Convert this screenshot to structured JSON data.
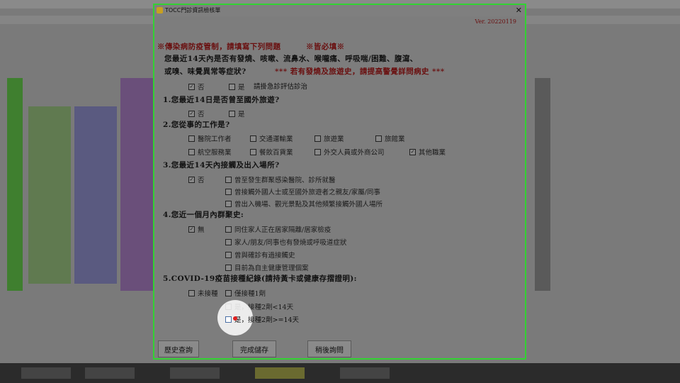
{
  "window": {
    "title": "TOCC門診資訊檢核單",
    "version": "Ver. 20220119"
  },
  "header": {
    "notice": "※傳染病防疫管制，請填寫下列問題",
    "required": "※皆必填※",
    "line1": "您最近14天內是否有發燒、咳嗽、流鼻水、喉嚨痛、呼吸喘/困難、腹瀉、",
    "line2": "或嗅、味覺異常等症狀?",
    "warning": "*** 若有發燒及旅遊史，請提高警覺詳問病史 ***"
  },
  "symptoms": {
    "no": {
      "label": "否",
      "checked": true
    },
    "yes": {
      "label": "是",
      "checked": false
    },
    "yes_note": "請掛急診評估診治"
  },
  "q1": {
    "title": "1.您最近14日是否曾至國外旅遊?",
    "no": {
      "label": "否",
      "checked": true
    },
    "yes": {
      "label": "是",
      "checked": false
    }
  },
  "q2": {
    "title": "2.您從事的工作是?",
    "options": [
      {
        "label": "醫院工作者",
        "checked": false
      },
      {
        "label": "交通運輸業",
        "checked": false
      },
      {
        "label": "旅遊業",
        "checked": false
      },
      {
        "label": "旅館業",
        "checked": false
      },
      {
        "label": "航空服務業",
        "checked": false
      },
      {
        "label": "餐飲百貨業",
        "checked": false
      },
      {
        "label": "外交人員或外商公司",
        "checked": false
      },
      {
        "label": "其他職業",
        "checked": true
      }
    ]
  },
  "q3": {
    "title": "3.您最近14天內接觸及出入場所?",
    "no": {
      "label": "否",
      "checked": true
    },
    "options": [
      {
        "label": "曾至發生群聚感染醫院、診所就醫",
        "checked": false
      },
      {
        "label": "曾接觸外國人士或至國外旅遊者之親友/家屬/同事",
        "checked": false
      },
      {
        "label": "曾出入機場、觀光景點及其他頻繁接觸外國人場所",
        "checked": false
      }
    ]
  },
  "q4": {
    "title": "4.您近一個月內群聚史:",
    "none": {
      "label": "無",
      "checked": true
    },
    "options": [
      {
        "label": "同住家人正在居家隔離/居家檢疫",
        "checked": false
      },
      {
        "label": "家人/朋友/同事也有發燒或呼吸道症狀",
        "checked": false
      },
      {
        "label": "曾與確診有過接觸史",
        "checked": false
      },
      {
        "label": "目前為自主健康管理個案",
        "checked": false
      }
    ]
  },
  "q5": {
    "title": "5.COVID-19疫苗接種紀錄(請持黃卡或健康存摺證明):",
    "options": [
      {
        "label": "未接種",
        "checked": false
      },
      {
        "label": "僅接種1劑",
        "checked": false
      },
      {
        "label": "是，接種2劑<14天",
        "checked": false
      },
      {
        "label": "是，接種2劑>=14天",
        "checked": false
      }
    ]
  },
  "buttons": {
    "history": "歷史查詢",
    "save": "完成儲存",
    "later": "稍後詢問"
  },
  "colors": {
    "dialog_border": "#32d232",
    "required_text": "#6a0f0f",
    "cursor": "#e02020"
  }
}
